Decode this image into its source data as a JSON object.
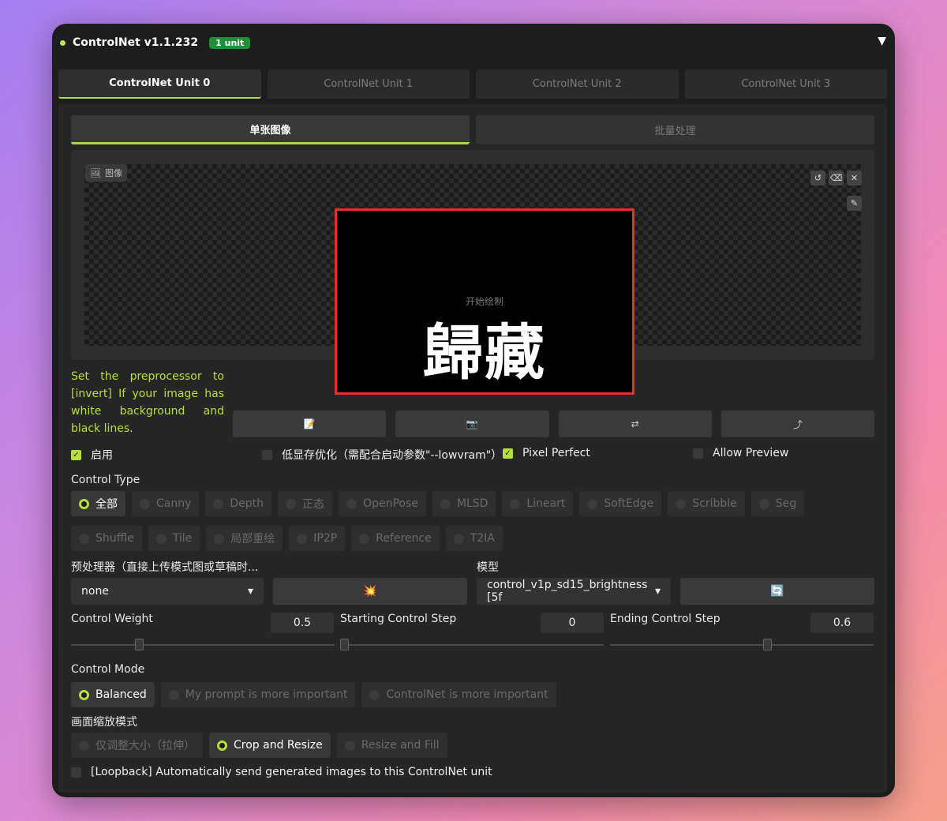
{
  "header": {
    "title": "ControlNet v1.1.232",
    "badge": "1 unit",
    "collapse_icon": "▼"
  },
  "unit_tabs": [
    "ControlNet Unit 0",
    "ControlNet Unit 1",
    "ControlNet Unit 2",
    "ControlNet Unit 3"
  ],
  "mode_tabs": [
    "单张图像",
    "批量处理"
  ],
  "image_panel": {
    "label": "图像",
    "hint": "开始绘制",
    "content_text": "歸藏"
  },
  "note": "Set the preprocessor to [invert] If your image has white background and black lines.",
  "action_icons": [
    "📝",
    "📷",
    "⇄",
    "⤴"
  ],
  "options": {
    "enable": {
      "label": "启用",
      "checked": true
    },
    "lowvram": {
      "label": "低显存优化（需配合启动参数\"--lowvram\"）",
      "checked": false
    },
    "pixel_perfect": {
      "label": "Pixel Perfect",
      "checked": true
    },
    "allow_preview": {
      "label": "Allow Preview",
      "checked": false
    }
  },
  "control_type": {
    "label": "Control Type",
    "selected": "全部",
    "row1": [
      "全部",
      "Canny",
      "Depth",
      "正态",
      "OpenPose",
      "MLSD",
      "Lineart",
      "SoftEdge",
      "Scribble",
      "Seg"
    ],
    "row2": [
      "Shuffle",
      "Tile",
      "局部重绘",
      "IP2P",
      "Reference",
      "T2IA"
    ]
  },
  "preprocessor": {
    "label": "预处理器（直接上传模式图或草稿时...",
    "value": "none",
    "run_icon": "💥"
  },
  "model": {
    "label": "模型",
    "value": "control_v1p_sd15_brightness [5f",
    "refresh_icon": "🔄"
  },
  "sliders": {
    "control_weight": {
      "label": "Control Weight",
      "value": "0.5",
      "fraction": 0.25
    },
    "start_step": {
      "label": "Starting Control Step",
      "value": "0",
      "fraction": 0.0
    },
    "end_step": {
      "label": "Ending Control Step",
      "value": "0.6",
      "fraction": 0.6
    }
  },
  "control_mode": {
    "label": "Control Mode",
    "selected": "Balanced",
    "options": [
      "Balanced",
      "My prompt is more important",
      "ControlNet is more important"
    ]
  },
  "resize_mode": {
    "label": "画面缩放模式",
    "selected": "Crop and Resize",
    "options": [
      "仅调整大小（拉伸）",
      "Crop and Resize",
      "Resize and Fill"
    ]
  },
  "loopback": {
    "label": "[Loopback] Automatically send generated images to this ControlNet unit",
    "checked": false
  },
  "colors": {
    "accent": "#b5e03a",
    "highlight_border": "#e0322a",
    "badge": "#1f8f3a"
  }
}
